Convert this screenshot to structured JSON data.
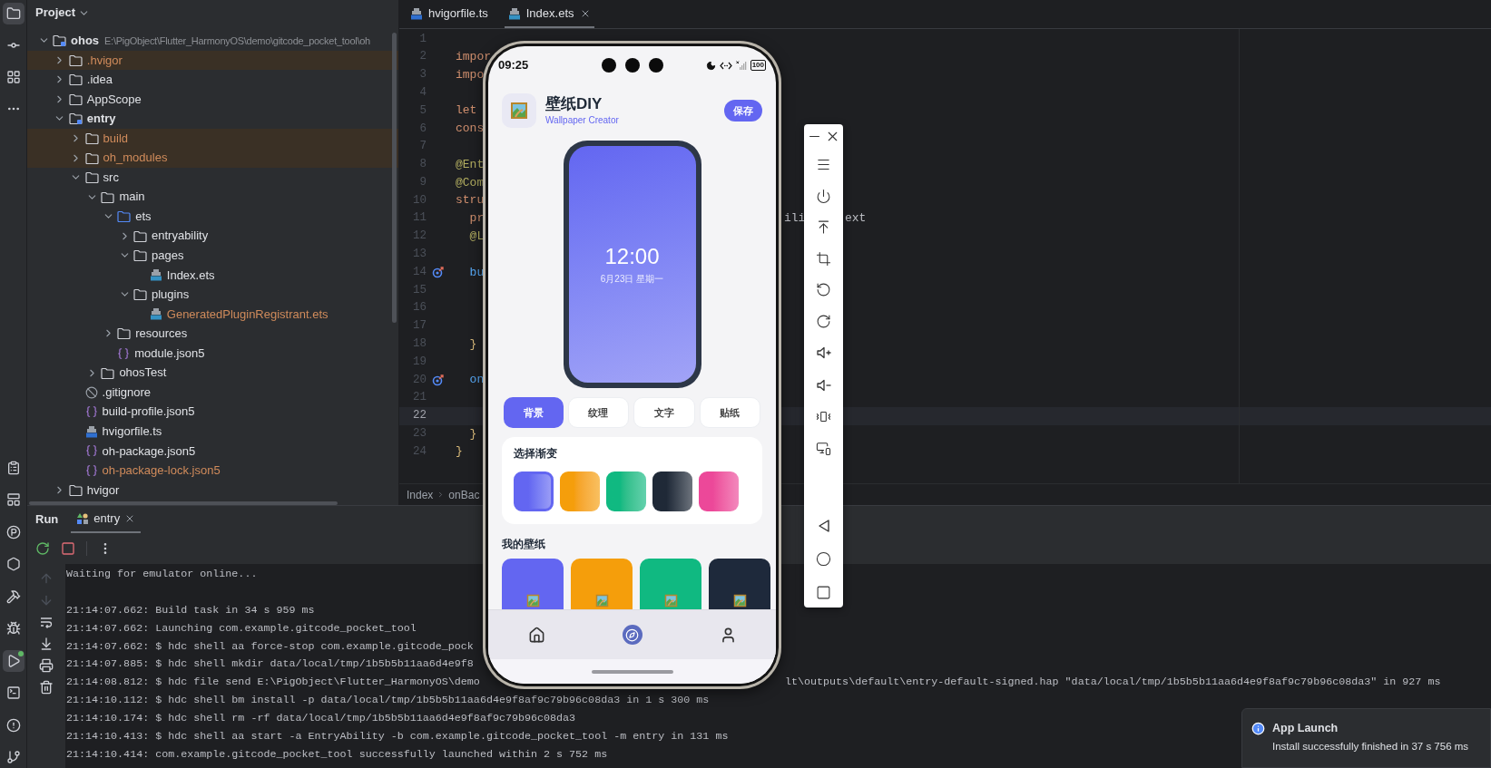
{
  "tool_strip": {
    "top": [
      {
        "kind": "project",
        "selected": true
      },
      {
        "kind": "commit",
        "selected": false
      },
      {
        "kind": "structure",
        "selected": false
      },
      {
        "kind": "more",
        "selected": false
      }
    ],
    "bottom": [
      {
        "kind": "todo",
        "selected": false,
        "badge": false
      },
      {
        "kind": "layout",
        "selected": false,
        "badge": false
      },
      {
        "kind": "profiler",
        "selected": false,
        "badge": false
      },
      {
        "kind": "services",
        "selected": false,
        "badge": false
      },
      {
        "kind": "build",
        "selected": false,
        "badge": false
      },
      {
        "kind": "debug",
        "selected": false,
        "badge": false
      },
      {
        "kind": "run",
        "selected": true,
        "badge": true
      },
      {
        "kind": "terminal",
        "selected": false,
        "badge": false
      },
      {
        "kind": "problems",
        "selected": false,
        "badge": false
      },
      {
        "kind": "git",
        "selected": false,
        "badge": false
      }
    ]
  },
  "project": {
    "title": "Project",
    "tree": [
      {
        "label": "ohos",
        "kind": "module",
        "path": "E:\\PigObject\\Flutter_HarmonyOS\\demo\\gitcode_pocket_tool\\oh",
        "expanded": true,
        "excluded": false,
        "ignored": false,
        "children": [
          {
            "label": ".hvigor",
            "kind": "folder",
            "expanded": false,
            "excluded": true,
            "ignored": true
          },
          {
            "label": ".idea",
            "kind": "folder",
            "expanded": false,
            "excluded": false,
            "ignored": false
          },
          {
            "label": "AppScope",
            "kind": "folder",
            "expanded": false,
            "excluded": false,
            "ignored": false
          },
          {
            "label": "entry",
            "kind": "module",
            "expanded": true,
            "excluded": false,
            "ignored": false,
            "children": [
              {
                "label": "build",
                "kind": "folder",
                "expanded": false,
                "excluded": true,
                "ignored": true
              },
              {
                "label": "oh_modules",
                "kind": "folder",
                "expanded": false,
                "excluded": true,
                "ignored": true
              },
              {
                "label": "src",
                "kind": "folder",
                "expanded": true,
                "excluded": false,
                "ignored": false,
                "children": [
                  {
                    "label": "main",
                    "kind": "folder",
                    "expanded": true,
                    "excluded": false,
                    "ignored": false,
                    "children": [
                      {
                        "label": "ets",
                        "kind": "source",
                        "expanded": true,
                        "excluded": false,
                        "ignored": false,
                        "children": [
                          {
                            "label": "entryability",
                            "kind": "folder",
                            "expanded": false,
                            "excluded": false,
                            "ignored": false
                          },
                          {
                            "label": "pages",
                            "kind": "folder",
                            "expanded": true,
                            "excluded": false,
                            "ignored": false,
                            "children": [
                              {
                                "label": "Index.ets",
                                "kind": "ets",
                                "excluded": false,
                                "ignored": false
                              }
                            ]
                          },
                          {
                            "label": "plugins",
                            "kind": "folder",
                            "expanded": true,
                            "excluded": false,
                            "ignored": false,
                            "children": [
                              {
                                "label": "GeneratedPluginRegistrant.ets",
                                "kind": "ets",
                                "excluded": false,
                                "ignored": true
                              }
                            ]
                          }
                        ]
                      },
                      {
                        "label": "resources",
                        "kind": "folder",
                        "expanded": false,
                        "excluded": false,
                        "ignored": false
                      },
                      {
                        "label": "module.json5",
                        "kind": "json",
                        "excluded": false,
                        "ignored": false
                      }
                    ]
                  },
                  {
                    "label": "ohosTest",
                    "kind": "folder",
                    "expanded": false,
                    "excluded": false,
                    "ignored": false
                  }
                ]
              },
              {
                "label": ".gitignore",
                "kind": "ignore",
                "excluded": false,
                "ignored": false
              },
              {
                "label": "build-profile.json5",
                "kind": "json",
                "excluded": false,
                "ignored": false
              },
              {
                "label": "hvigorfile.ts",
                "kind": "ts",
                "excluded": false,
                "ignored": false
              },
              {
                "label": "oh-package.json5",
                "kind": "json",
                "excluded": false,
                "ignored": false
              },
              {
                "label": "oh-package-lock.json5",
                "kind": "json",
                "excluded": false,
                "ignored": true
              }
            ]
          },
          {
            "label": "hvigor",
            "kind": "folder",
            "expanded": false,
            "excluded": false,
            "ignored": false
          }
        ]
      }
    ]
  },
  "editor": {
    "tabs": [
      {
        "label": "hvigorfile.ts",
        "kind": "ts",
        "selected": false,
        "closable": false
      },
      {
        "label": "Index.ets",
        "kind": "ets",
        "selected": true,
        "closable": true
      }
    ],
    "lines": [
      {
        "number": "1",
        "current": false,
        "marker": false
      },
      {
        "number": "2",
        "current": false,
        "marker": false,
        "parts": [
          {
            "text": "impor",
            "kind": "keyword"
          }
        ]
      },
      {
        "number": "3",
        "current": false,
        "marker": false,
        "parts": [
          {
            "text": "impo",
            "kind": "keyword"
          }
        ]
      },
      {
        "number": "4",
        "current": false,
        "marker": false
      },
      {
        "number": "5",
        "current": false,
        "marker": false,
        "parts": [
          {
            "text": "let",
            "kind": "keyword"
          }
        ]
      },
      {
        "number": "6",
        "current": false,
        "marker": false,
        "parts": [
          {
            "text": "cons",
            "kind": "keyword"
          }
        ]
      },
      {
        "number": "7",
        "current": false,
        "marker": false
      },
      {
        "number": "8",
        "current": false,
        "marker": false,
        "parts": [
          {
            "text": "@Ent",
            "kind": "decorator"
          }
        ]
      },
      {
        "number": "9",
        "current": false,
        "marker": false,
        "parts": [
          {
            "text": "@Com",
            "kind": "decorator"
          }
        ]
      },
      {
        "number": "10",
        "current": false,
        "marker": false,
        "parts": [
          {
            "text": "stru",
            "kind": "keyword"
          }
        ]
      },
      {
        "number": "11",
        "current": false,
        "marker": false,
        "parts": [
          {
            "text": "  pr",
            "kind": "keyword"
          }
        ],
        "right_parts": [
          {
            "text": "ili",
            "kind": "plain"
          },
          {
            "text": "ext",
            "kind": "plain"
          }
        ]
      },
      {
        "number": "12",
        "current": false,
        "marker": false,
        "parts": [
          {
            "text": "  @L",
            "kind": "decorator"
          }
        ]
      },
      {
        "number": "13",
        "current": false,
        "marker": false
      },
      {
        "number": "14",
        "current": false,
        "marker": true,
        "parts": [
          {
            "text": "  bu",
            "kind": "function"
          }
        ]
      },
      {
        "number": "15",
        "current": false,
        "marker": false
      },
      {
        "number": "16",
        "current": false,
        "marker": false
      },
      {
        "number": "17",
        "current": false,
        "marker": false
      },
      {
        "number": "18",
        "current": false,
        "marker": false,
        "parts": [
          {
            "text": "  }",
            "kind": "brace"
          }
        ]
      },
      {
        "number": "19",
        "current": false,
        "marker": false
      },
      {
        "number": "20",
        "current": false,
        "marker": true,
        "parts": [
          {
            "text": "  on",
            "kind": "function"
          }
        ]
      },
      {
        "number": "21",
        "current": false,
        "marker": false
      },
      {
        "number": "22",
        "current": true,
        "marker": false
      },
      {
        "number": "23",
        "current": false,
        "marker": false,
        "parts": [
          {
            "text": "  }",
            "kind": "brace"
          }
        ]
      },
      {
        "number": "24",
        "current": false,
        "marker": false,
        "parts": [
          {
            "text": "}",
            "kind": "brace"
          }
        ]
      }
    ],
    "breadcrumb": [
      "Index",
      "onBac"
    ]
  },
  "run_panel": {
    "title": "Run",
    "tabs": [
      {
        "label": "entry",
        "selected": true
      }
    ],
    "tools": [
      {
        "kind": "rerun",
        "disabled": false
      },
      {
        "kind": "stop",
        "disabled": false
      },
      {
        "kind": "more",
        "disabled": false
      }
    ],
    "side_tools": [
      {
        "kind": "up",
        "disabled": true
      },
      {
        "kind": "down",
        "disabled": true
      },
      {
        "kind": "wrap",
        "disabled": false
      },
      {
        "kind": "scroll-end",
        "disabled": false
      },
      {
        "kind": "print",
        "disabled": false
      },
      {
        "kind": "clear",
        "disabled": false
      }
    ],
    "lines": [
      {
        "kind": "text",
        "text": "Waiting for emulator online..."
      },
      {
        "kind": "blank"
      },
      {
        "kind": "text",
        "text": "21:14:07.662: Build task in 34 s 959 ms"
      },
      {
        "kind": "text",
        "text": "21:14:07.662: Launching com.example.gitcode_pocket_tool"
      },
      {
        "kind": "text",
        "text": "21:14:07.662: $ hdc shell aa force-stop com.example.gitcode_pock"
      },
      {
        "kind": "text",
        "text": "21:14:07.885: $ hdc shell mkdir data/local/tmp/1b5b5b11aa6d4e9f8"
      },
      {
        "kind": "text",
        "text": "21:14:08.812: $ hdc file send E:\\PigObject\\Flutter_HarmonyOS\\demo",
        "text_right": "lt\\outputs\\default\\entry-default-signed.hap \"data/local/tmp/1b5b5b11aa6d4e9f8af9c79b96c08da3\" in 927 ms"
      },
      {
        "kind": "text",
        "text": "21:14:10.112: $ hdc shell bm install -p data/local/tmp/1b5b5b11aa6d4e9f8af9c79b96c08da3 in 1 s 300 ms"
      },
      {
        "kind": "text",
        "text": "21:14:10.174: $ hdc shell rm -rf data/local/tmp/1b5b5b11aa6d4e9f8af9c79b96c08da3"
      },
      {
        "kind": "text",
        "text": "21:14:10.413: $ hdc shell aa start -a EntryAbility -b com.example.gitcode_pocket_tool -m entry in 131 ms"
      },
      {
        "kind": "text",
        "text": "21:14:10.414: com.example.gitcode_pocket_tool successfully launched within 2 s 752 ms"
      }
    ]
  },
  "emulator": {
    "status": {
      "time": "09:25",
      "battery": "100"
    },
    "app": {
      "title": "壁纸DIY",
      "subtitle": "Wallpaper Creator",
      "save": "保存"
    },
    "preview": {
      "time": "12:00",
      "date": "6月23日 星期一"
    },
    "tabs": [
      {
        "label": "背景",
        "selected": true
      },
      {
        "label": "纹理",
        "selected": false
      },
      {
        "label": "文字",
        "selected": false
      },
      {
        "label": "贴纸",
        "selected": false
      }
    ],
    "gradient_title": "选择渐变",
    "gradients": [
      {
        "color": "#6366f1",
        "selected": true
      },
      {
        "color": "#f59e0b",
        "selected": false
      },
      {
        "color": "#10b981",
        "selected": false
      },
      {
        "color": "#1f2937",
        "selected": false
      },
      {
        "color": "#ec4899",
        "selected": false
      }
    ],
    "wallpapers_title": "我的壁纸",
    "wallpapers": [
      {
        "color": "#6366f1"
      },
      {
        "color": "#f59e0b"
      },
      {
        "color": "#10b981"
      },
      {
        "color": "#1e293b"
      }
    ],
    "nav": [
      {
        "kind": "home",
        "selected": false
      },
      {
        "kind": "discover",
        "selected": true
      },
      {
        "kind": "profile",
        "selected": false
      }
    ]
  },
  "emulator_toolbar": {
    "window": [
      {
        "kind": "minimize"
      },
      {
        "kind": "close"
      }
    ],
    "tools": [
      {
        "kind": "menu"
      },
      {
        "kind": "power"
      },
      {
        "kind": "upload"
      },
      {
        "kind": "crop"
      },
      {
        "kind": "rotate-left"
      },
      {
        "kind": "rotate-right"
      },
      {
        "kind": "volume-up"
      },
      {
        "kind": "volume-down"
      },
      {
        "kind": "shake"
      },
      {
        "kind": "multi-device"
      }
    ],
    "nav": [
      {
        "kind": "back"
      },
      {
        "kind": "home"
      },
      {
        "kind": "recents"
      }
    ]
  },
  "notification": {
    "title": "App Launch",
    "message": "Install successfully finished in 37 s 756 ms"
  }
}
